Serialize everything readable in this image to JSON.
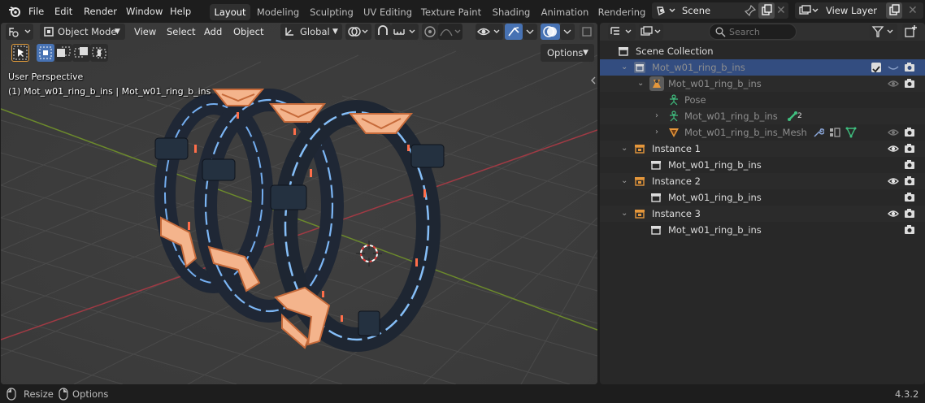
{
  "menu": {
    "file": "File",
    "edit": "Edit",
    "render": "Render",
    "window": "Window",
    "help": "Help"
  },
  "workspaces": [
    "Layout",
    "Modeling",
    "Sculpting",
    "UV Editing",
    "Texture Paint",
    "Shading",
    "Animation",
    "Rendering"
  ],
  "active_workspace": "Layout",
  "scene": {
    "name": "Scene"
  },
  "view_layer": {
    "name": "View Layer"
  },
  "viewport": {
    "mode": "Object Mode",
    "menus": {
      "view": "View",
      "select": "Select",
      "add": "Add",
      "object": "Object"
    },
    "orientation": "Global",
    "options_label": "Options",
    "perspective_label": "User Perspective",
    "object_label": "(1) Mot_w01_ring_b_ins | Mot_w01_ring_b_ins"
  },
  "outliner": {
    "search_placeholder": "Search",
    "rows": {
      "scene_collection": "Scene Collection",
      "collection": "Mot_w01_ring_b_ins",
      "armature": "Mot_w01_ring_b_ins",
      "pose": "Pose",
      "armature_data": "Mot_w01_ring_b_ins",
      "armature_data_badge": "2",
      "mesh": "Mot_w01_ring_b_ins_Mesh",
      "instance1": "Instance 1",
      "instance1_child": "Mot_w01_ring_b_ins",
      "instance2": "Instance 2",
      "instance2_child": "Mot_w01_ring_b_ins",
      "instance3": "Instance 3",
      "instance3_child": "Mot_w01_ring_b_ins"
    }
  },
  "status": {
    "resize": "Resize",
    "options": "Options",
    "version": "4.3.2"
  },
  "colors": {
    "accent_blue": "#4772b3",
    "selection_row": "#334d80",
    "collection_orange": "#e5973b",
    "armature_green": "#3fbf7f",
    "axis_red": "#b4424a",
    "axis_green": "#6f8f2e"
  }
}
